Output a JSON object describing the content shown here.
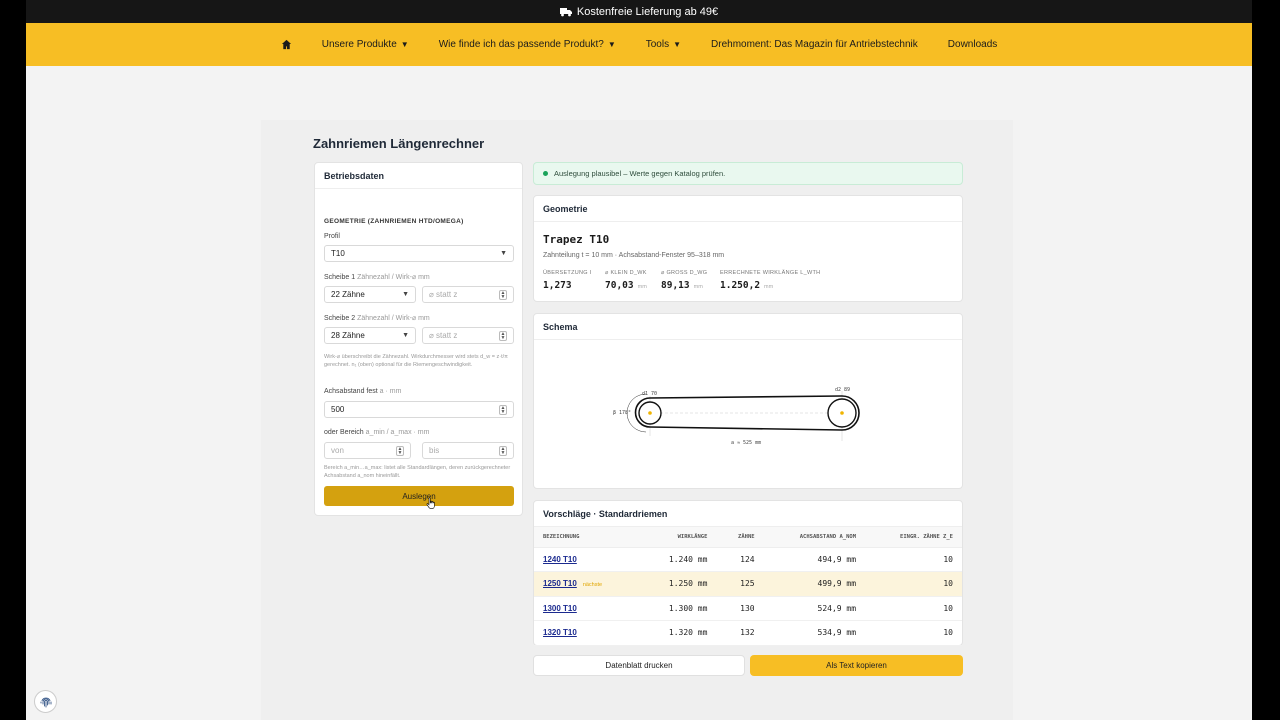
{
  "promo": {
    "icon": "truck-icon",
    "text": "Kostenfreie Lieferung ab 49€"
  },
  "nav": {
    "home_icon": "home-icon",
    "items": [
      "Unsere Produkte",
      "Wie finde ich das passende Produkt?",
      "Tools",
      "Drehmoment: Das Magazin für Antriebstechnik",
      "Downloads"
    ]
  },
  "page_title": "Zahnriemen Längenrechner",
  "form": {
    "title": "Betriebsdaten",
    "section": "GEOMETRIE (ZAHNRIEMEN HTD/OMEGA)",
    "profil_label": "Profil",
    "profil_value": "T10",
    "s1_label": "Scheibe 1",
    "s1_sub": "Zähnezahl / Wirk-⌀ mm",
    "s1_value": "22 Zähne",
    "s1_placeholder": "⌀ statt z",
    "s2_label": "Scheibe 2",
    "s2_sub": "Zähnezahl / Wirk-⌀ mm",
    "s2_value": "28 Zähne",
    "s2_placeholder": "⌀ statt z",
    "hint1": "Wirk-⌀ überschreibt die Zähnezahl. Wirkdurchmesser wird stets d_w = z·t/π gerechnet. n₁ (oben) optional für die Riemengeschwindigkeit.",
    "achs_label": "Achsabstand fest",
    "achs_sub": "a · mm",
    "achs_value": "500",
    "bereich_label": "oder Bereich",
    "bereich_sub": "a_min / a_max · mm",
    "von_placeholder": "von",
    "bis_placeholder": "bis",
    "hint2": "Bereich a_min…a_max: listet alle Standardlängen, deren zurückgerechneter Achsabstand a_nom hineinfällt.",
    "button": "Auslegen"
  },
  "status": {
    "text": "Auslegung plausibel – Werte gegen Katalog prüfen.",
    "color": "#1aa35a"
  },
  "geometrie": {
    "title": "Geometrie",
    "name": "Trapez T10",
    "sub": "Zahnteilung t = 10 mm · Achsabstand-Fenster 95–318 mm",
    "metrics": [
      {
        "label": "Übersetzung i",
        "value": "1,273",
        "unit": ""
      },
      {
        "label": "⌀ klein d_wk",
        "value": "70,03",
        "unit": "mm"
      },
      {
        "label": "⌀ groß d_wg",
        "value": "89,13",
        "unit": "mm"
      },
      {
        "label": "Errechnete Wirklänge L_wth",
        "value": "1.250,2",
        "unit": "mm"
      }
    ]
  },
  "schema": {
    "title": "Schema",
    "d1": "d1 70",
    "d2": "d2 89",
    "angle": "β 178°",
    "axis": "a ≈ 525 mm"
  },
  "vorschlaege": {
    "title": "Vorschläge · Standardriemen",
    "columns": [
      "Bezeichnung",
      "Wirklänge",
      "Zähne",
      "Achsabstand a_nom",
      "Eingr. Zähne z_e"
    ],
    "rows": [
      {
        "name": "1240 T10",
        "badge": "",
        "length": "1.240 mm",
        "teeth": "124",
        "axis": "494,9 mm",
        "ze": "10"
      },
      {
        "name": "1250 T10",
        "badge": "nächste",
        "length": "1.250 mm",
        "teeth": "125",
        "axis": "499,9 mm",
        "ze": "10"
      },
      {
        "name": "1300 T10",
        "badge": "",
        "length": "1.300 mm",
        "teeth": "130",
        "axis": "524,9 mm",
        "ze": "10"
      },
      {
        "name": "1320 T10",
        "badge": "",
        "length": "1.320 mm",
        "teeth": "132",
        "axis": "534,9 mm",
        "ze": "10"
      }
    ]
  },
  "buttons": {
    "print": "Datenblatt drucken",
    "copy": "Als Text kopieren"
  },
  "privacy_icon": "fingerprint-icon",
  "colors": {
    "accent": "#f7be24",
    "button": "#d4a10f",
    "link": "#1b2a8f"
  }
}
